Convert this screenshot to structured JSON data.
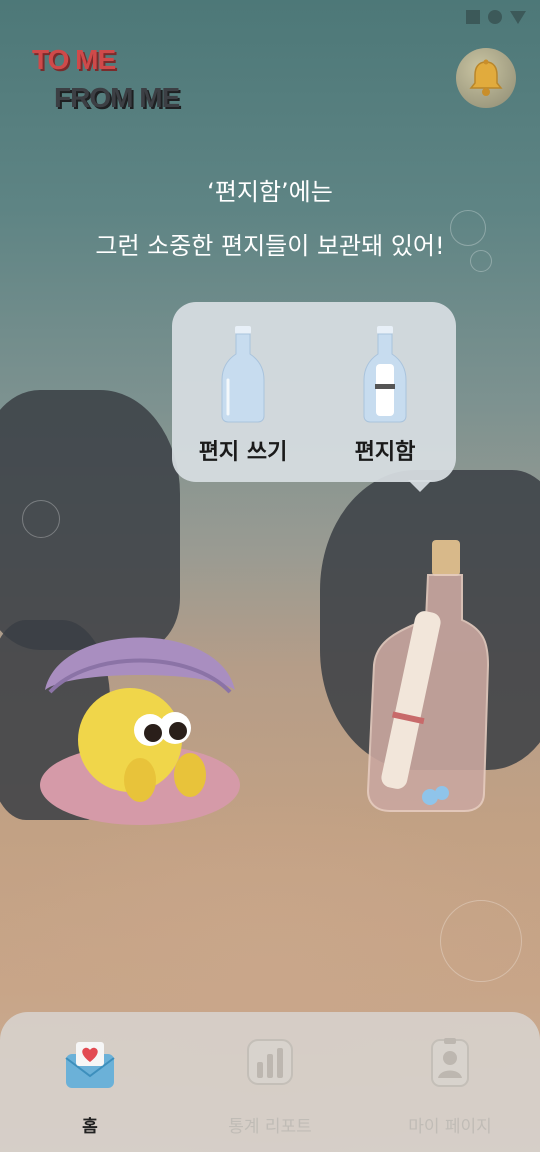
{
  "logo": {
    "line1": "TO ME",
    "line2": "FROM ME"
  },
  "message": {
    "line1": "‘편지함’에는",
    "line2": "그런 소중한 편지들이 보관돼 있어!"
  },
  "popup": {
    "options": [
      {
        "label": "편지 쓰기",
        "icon": "empty-bottle-icon"
      },
      {
        "label": "편지함",
        "icon": "letter-bottle-icon"
      }
    ]
  },
  "nav": {
    "items": [
      {
        "label": "홈",
        "icon": "heart-envelope-icon",
        "active": true
      },
      {
        "label": "통계 리포트",
        "icon": "bar-chart-icon",
        "active": false
      },
      {
        "label": "마이 페이지",
        "icon": "profile-card-icon",
        "active": false
      }
    ]
  },
  "colors": {
    "accent_red": "#cf4a4a",
    "popup_bg": "#d7dee2",
    "nav_bg": "#d7d3ce"
  }
}
